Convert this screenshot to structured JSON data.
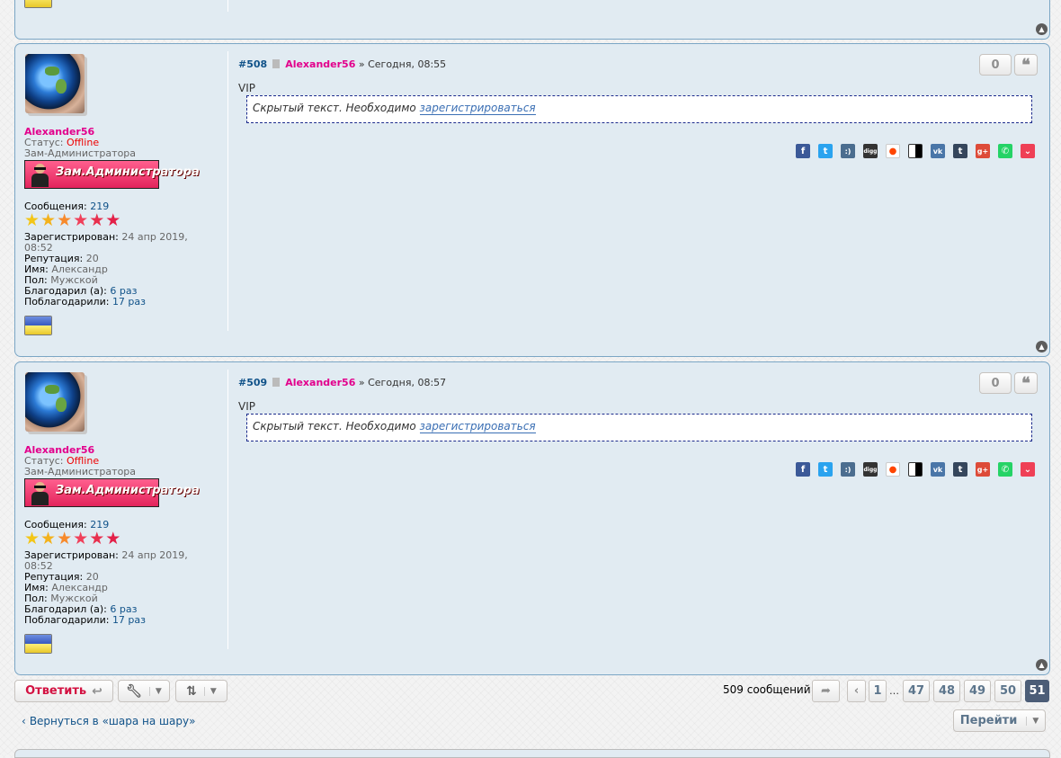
{
  "posts": [
    {
      "number": "#508",
      "author": "Alexander56",
      "separator": "»",
      "date": "Сегодня, 08:55",
      "reactions": "0",
      "body_label": "VIP",
      "hidden_text": "Скрытый текст. Необходимо",
      "hidden_link": "зарегистрироваться",
      "profile": {
        "name": "Alexander56",
        "status_label": "Статус:",
        "status_value": "Offline",
        "group": "Зам-Администратора",
        "rank_image_text": "Зам.Администратора",
        "messages_label": "Сообщения:",
        "messages_value": "219",
        "registered_label": "Зарегистрирован:",
        "registered_value": "24 апр 2019,",
        "registered_time": "08:52",
        "reputation_label": "Репутация:",
        "reputation_value": "20",
        "first_name_label": "Имя:",
        "first_name_value": "Александр",
        "gender_label": "Пол:",
        "gender_value": "Мужской",
        "thanked_label": "Благодарил (а):",
        "thanked_value": "6 раз",
        "was_thanked_label": "Поблагодарили:",
        "was_thanked_value": "17 раз"
      }
    },
    {
      "number": "#509",
      "author": "Alexander56",
      "separator": "»",
      "date": "Сегодня, 08:57",
      "reactions": "0",
      "body_label": "VIP",
      "hidden_text": "Скрытый текст. Необходимо",
      "hidden_link": "зарегистрироваться",
      "profile": {
        "name": "Alexander56",
        "status_label": "Статус:",
        "status_value": "Offline",
        "group": "Зам-Администратора",
        "rank_image_text": "Зам.Администратора",
        "messages_label": "Сообщения:",
        "messages_value": "219",
        "registered_label": "Зарегистрирован:",
        "registered_value": "24 апр 2019,",
        "registered_time": "08:52",
        "reputation_label": "Репутация:",
        "reputation_value": "20",
        "first_name_label": "Имя:",
        "first_name_value": "Александр",
        "gender_label": "Пол:",
        "gender_value": "Мужской",
        "thanked_label": "Благодарил (а):",
        "thanked_value": "6 раз",
        "was_thanked_label": "Поблагодарили:",
        "was_thanked_value": "17 раз"
      }
    }
  ],
  "share_icons": [
    "facebook-icon",
    "twitter-icon",
    "juick-icon",
    "digg-icon",
    "reddit-icon",
    "delicious-icon",
    "vk-icon",
    "tumblr-icon",
    "google-plus-icon",
    "whatsapp-icon",
    "pocket-icon"
  ],
  "share_glyphs": {
    "facebook": "f",
    "twitter": "t",
    "juick": ":)",
    "digg": "digg",
    "vk": "vk",
    "tumblr": "t",
    "gplus": "g+"
  },
  "toolbar": {
    "reply_label": "Ответить",
    "post_count": "509 сообщений",
    "pages": [
      "1",
      "47",
      "48",
      "49",
      "50",
      "51"
    ],
    "ellipsis": "…",
    "current_page": "51"
  },
  "footer": {
    "back_link": "Вернуться в «шара на шару»",
    "jump_label": "Перейти"
  },
  "colors": {
    "post_bg": "#e1ebf2",
    "username": "#e2008c",
    "offline": "#e00000",
    "reply": "#d31141",
    "link": "#105289",
    "active_page": "#4c5d77"
  }
}
